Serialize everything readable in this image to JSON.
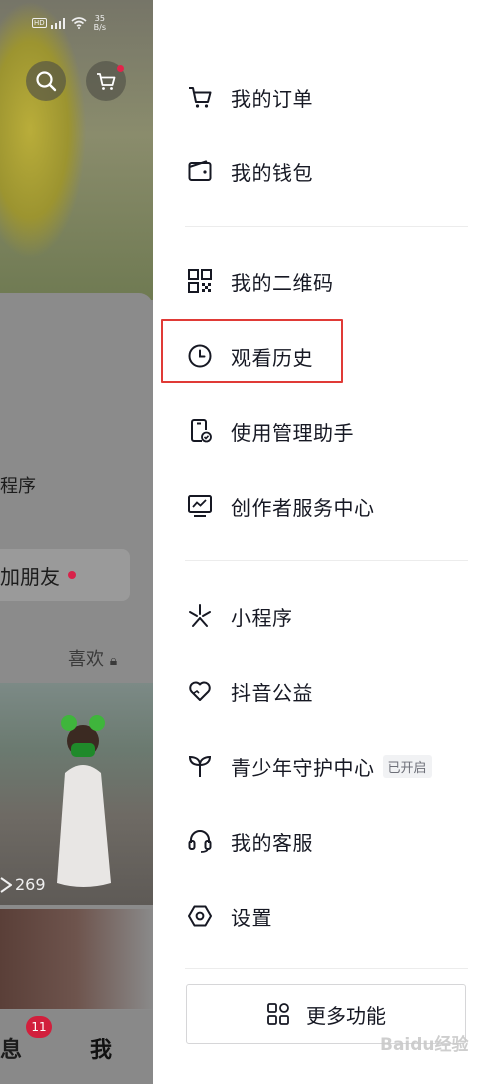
{
  "status_bar": {
    "hd": "HD",
    "network": "5G",
    "speed_value": "35",
    "speed_unit": "B/s"
  },
  "left_panel": {
    "partial_line_1": "程序",
    "add_friend_label": "加朋友",
    "tab_likes": "喜欢",
    "play_count": "269",
    "nav_message_partial": "息",
    "nav_message_badge": "11",
    "nav_me": "我"
  },
  "drawer": {
    "group1": [
      {
        "label": "我的订单",
        "icon": "cart-icon"
      },
      {
        "label": "我的钱包",
        "icon": "wallet-icon"
      }
    ],
    "group2": [
      {
        "label": "我的二维码",
        "icon": "qrcode-icon"
      },
      {
        "label": "观看历史",
        "icon": "clock-icon"
      },
      {
        "label": "使用管理助手",
        "icon": "phone-check-icon"
      },
      {
        "label": "创作者服务中心",
        "icon": "chart-icon"
      }
    ],
    "group3": [
      {
        "label": "小程序",
        "icon": "mini-program-icon"
      },
      {
        "label": "抖音公益",
        "icon": "heart-hands-icon"
      },
      {
        "label": "青少年守护中心",
        "icon": "sprout-icon",
        "tag": "已开启"
      },
      {
        "label": "我的客服",
        "icon": "headset-icon"
      },
      {
        "label": "设置",
        "icon": "hex-settings-icon"
      }
    ],
    "more_button": {
      "label": "更多功能",
      "icon": "apps-icon"
    }
  },
  "watermark": "Baidu经验",
  "colors": {
    "highlight_border": "#e03a36",
    "badge": "#d21f3c",
    "text": "#161823"
  }
}
